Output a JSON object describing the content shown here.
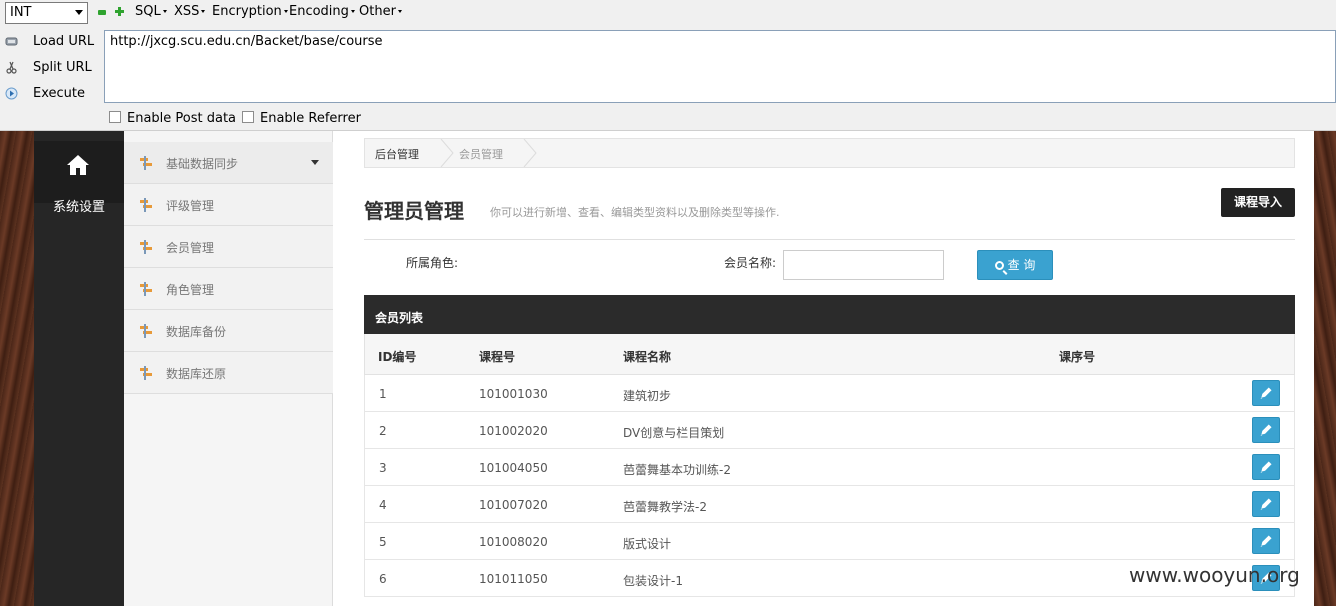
{
  "hackbar": {
    "select_value": "INT",
    "menus": [
      "SQL",
      "XSS",
      "Encryption",
      "Encoding",
      "Other"
    ],
    "side_actions": [
      {
        "label": "Load URL",
        "icon": "load-url-icon"
      },
      {
        "label": "Split URL",
        "icon": "scissors-icon"
      },
      {
        "label": "Execute",
        "icon": "execute-icon"
      }
    ],
    "url": "http://jxcg.scu.edu.cn/Backet/base/course",
    "checkboxes": [
      "Enable Post data",
      "Enable Referrer"
    ]
  },
  "nav": {
    "home_label": "系统设置"
  },
  "submenu": {
    "items": [
      "基础数据同步",
      "评级管理",
      "会员管理",
      "角色管理",
      "数据库备份",
      "数据库还原"
    ]
  },
  "breadcrumb": [
    "后台管理",
    "会员管理"
  ],
  "page": {
    "title": "管理员管理",
    "description": "你可以进行新增、查看、编辑类型资料以及删除类型等操作.",
    "import_button": "课程导入"
  },
  "filter": {
    "role_label": "所属角色:",
    "member_label": "会员名称:",
    "member_value": "",
    "query_button": "查 询"
  },
  "table": {
    "title": "会员列表",
    "columns": [
      "ID编号",
      "课程号",
      "课程名称",
      "课序号"
    ],
    "rows": [
      {
        "id": "1",
        "code": "101001030",
        "name": "建筑初步",
        "seq": ""
      },
      {
        "id": "2",
        "code": "101002020",
        "name": "DV创意与栏目策划",
        "seq": ""
      },
      {
        "id": "3",
        "code": "101004050",
        "name": "芭蕾舞基本功训练-2",
        "seq": ""
      },
      {
        "id": "4",
        "code": "101007020",
        "name": "芭蕾舞教学法-2",
        "seq": ""
      },
      {
        "id": "5",
        "code": "101008020",
        "name": "版式设计",
        "seq": ""
      },
      {
        "id": "6",
        "code": "101011050",
        "name": "包装设计-1",
        "seq": ""
      }
    ]
  },
  "watermark": "www.wooyun.org",
  "colors": {
    "accent": "#3aa2d0",
    "dark_nav": "#262626",
    "table_header": "#2b2b2b"
  }
}
